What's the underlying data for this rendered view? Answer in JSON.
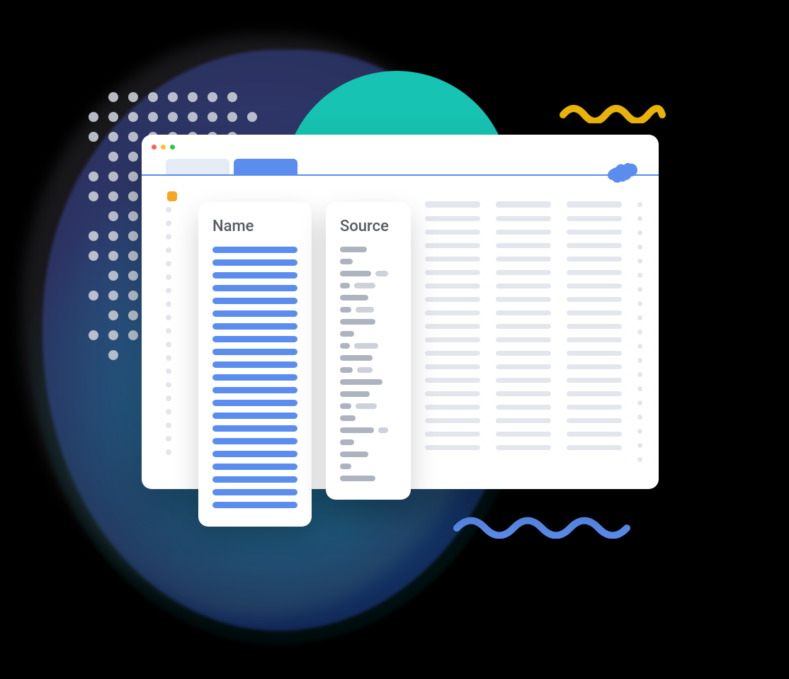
{
  "columns": {
    "name_header": "Name",
    "source_header": "Source"
  },
  "colors": {
    "accent_blue": "#5b8def",
    "teal": "#17c3b2",
    "yellow": "#eab308",
    "marker_orange": "#f5a623",
    "skeleton_gray": "#e3e6ec",
    "source_gray": "#aeb4bf"
  },
  "decorations": {
    "dot_grid_rows": 14,
    "dot_grid_cols": 9,
    "name_row_count": 21,
    "source_row_count": 20,
    "back_row_count": 19
  }
}
